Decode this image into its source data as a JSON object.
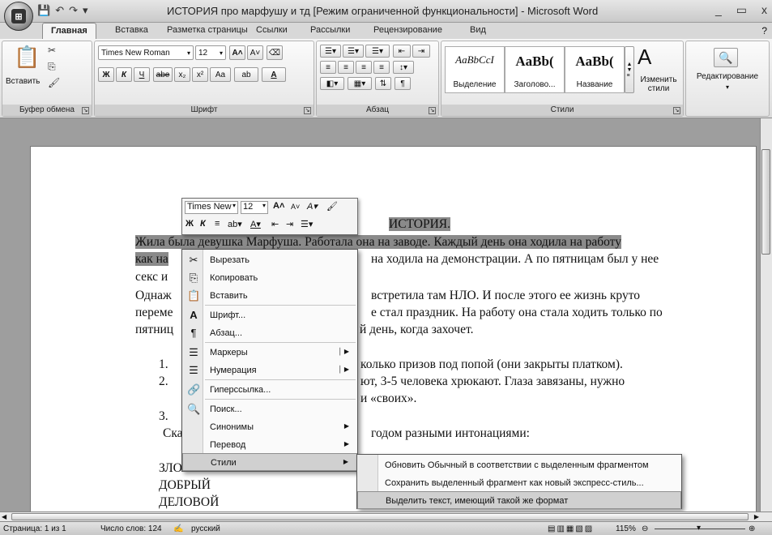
{
  "window": {
    "title": "ИСТОРИЯ про марфушу и тд [Режим ограниченной функциональности] - Microsoft Word",
    "controls": [
      "_",
      "▭",
      "x"
    ]
  },
  "tabs": [
    "Главная",
    "Вставка",
    "Разметка страницы",
    "Ссылки",
    "Рассылки",
    "Рецензирование",
    "Вид"
  ],
  "ribbon": {
    "clipboard": {
      "paste_label": "Вставить",
      "group_label": "Буфер обмена"
    },
    "font": {
      "font_name": "Times New Roman",
      "font_size": "12",
      "group_label": "Шрифт",
      "bold": "Ж",
      "italic": "К",
      "underline": "Ч",
      "strike": "abe",
      "sub": "x₂",
      "sup": "x²",
      "case": "Aa",
      "highlight": "ab",
      "color": "A"
    },
    "paragraph": {
      "group_label": "Абзац"
    },
    "styles": {
      "group_label": "Стили",
      "items": [
        {
          "sample": "AaBbCcI",
          "name": "Выделение"
        },
        {
          "sample": "AaBb(",
          "name": "Заголово..."
        },
        {
          "sample": "AaBb(",
          "name": "Название"
        }
      ],
      "change_styles": "Изменить стили"
    },
    "editing": {
      "label": "Редактирование"
    }
  },
  "document": {
    "title": "ИСТОРИЯ.",
    "lines": [
      "Жила была девушка Марфуша. Работала она на заводе. Каждый день она ходила на работу",
      "как на",
      "на ходила на демонстрации. А по пятницам был у нее",
      "секс и",
      "Однаж",
      "встретила там НЛО. И после этого ее жизнь круто",
      "переме",
      "е стал праздник. На работу она стала ходить только по",
      "пятниц",
      "й день, когда захочет.",
      "1.",
      "колько призов под попой (они закрыты платком).",
      "2.",
      "ют, 3-5 человека хрюкают. Глаза завязаны, нужно",
      "и «своих».",
      "3.",
      "Ска",
      "годом разными интонациями:",
      "ЗЛО",
      "ДОБРЫЙ",
      "ДЕЛОВОЙ"
    ]
  },
  "mini_toolbar": {
    "font": "Times New",
    "size": "12"
  },
  "context_menu": [
    {
      "label": "Вырезать",
      "icon": "scissors-icon",
      "glyph": "✂"
    },
    {
      "label": "Копировать",
      "icon": "copy-icon",
      "glyph": "⎘"
    },
    {
      "label": "Вставить",
      "icon": "paste-icon",
      "glyph": "📋"
    },
    {
      "label": "Шрифт...",
      "icon": "font-icon",
      "glyph": "A"
    },
    {
      "label": "Абзац...",
      "icon": "paragraph-icon",
      "glyph": "¶"
    },
    {
      "label": "Маркеры",
      "icon": "bullets-icon",
      "glyph": "☰"
    },
    {
      "label": "Нумерация",
      "icon": "numbering-icon",
      "glyph": "☰"
    },
    {
      "label": "Гиперссылка...",
      "icon": "hyperlink-icon",
      "glyph": "🔗"
    },
    {
      "label": "Поиск...",
      "icon": "search-icon",
      "glyph": "🔍"
    },
    {
      "label": "Синонимы",
      "icon": "",
      "glyph": ""
    },
    {
      "label": "Перевод",
      "icon": "",
      "glyph": ""
    },
    {
      "label": "Стили",
      "icon": "",
      "glyph": ""
    }
  ],
  "styles_submenu": [
    "Обновить Обычный в соответствии с выделенным фрагментом",
    "Сохранить выделенный фрагмент как новый экспресс-стиль...",
    "Выделить текст, имеющий такой же формат"
  ],
  "statusbar": {
    "page": "Страница: 1 из 1",
    "words": "Число слов: 124",
    "language": "русский",
    "zoom": "115%"
  }
}
